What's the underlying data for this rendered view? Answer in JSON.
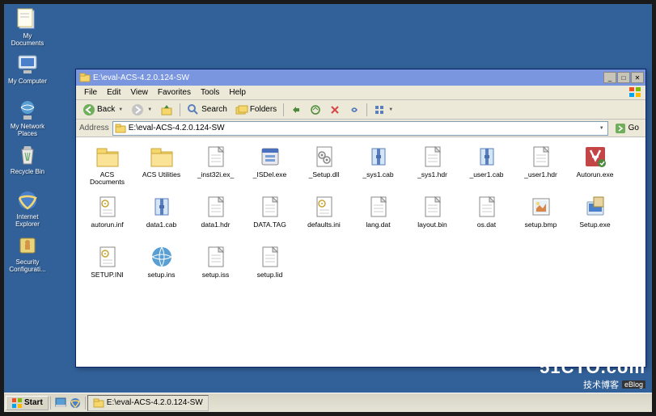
{
  "desktop_icons": [
    {
      "name": "my-documents",
      "label": "My Documents",
      "icon": "docs"
    },
    {
      "name": "my-computer",
      "label": "My Computer",
      "icon": "computer"
    },
    {
      "name": "my-network-places",
      "label": "My Network\nPlaces",
      "icon": "network"
    },
    {
      "name": "recycle-bin",
      "label": "Recycle Bin",
      "icon": "recycle"
    },
    {
      "name": "internet-explorer",
      "label": "Internet\nExplorer",
      "icon": "ie"
    },
    {
      "name": "security-config",
      "label": "Security\nConfigurati...",
      "icon": "security"
    }
  ],
  "window": {
    "title": "E:\\eval-ACS-4.2.0.124-SW",
    "menus": [
      "File",
      "Edit",
      "View",
      "Favorites",
      "Tools",
      "Help"
    ],
    "toolbar": {
      "back": "Back",
      "search": "Search",
      "folders": "Folders"
    },
    "address": {
      "label": "Address",
      "value": "E:\\eval-ACS-4.2.0.124-SW",
      "go": "Go"
    },
    "files": [
      {
        "label": "ACS\nDocuments",
        "icon": "folder"
      },
      {
        "label": "ACS Utilities",
        "icon": "folder"
      },
      {
        "label": "_inst32i.ex_",
        "icon": "file"
      },
      {
        "label": "_ISDel.exe",
        "icon": "exe"
      },
      {
        "label": "_Setup.dll",
        "icon": "dll"
      },
      {
        "label": "_sys1.cab",
        "icon": "cab"
      },
      {
        "label": "_sys1.hdr",
        "icon": "file"
      },
      {
        "label": "_user1.cab",
        "icon": "cab"
      },
      {
        "label": "_user1.hdr",
        "icon": "file"
      },
      {
        "label": "Autorun.exe",
        "icon": "autorun"
      },
      {
        "label": "autorun.inf",
        "icon": "inf"
      },
      {
        "label": "data1.cab",
        "icon": "cab"
      },
      {
        "label": "data1.hdr",
        "icon": "file"
      },
      {
        "label": "DATA.TAG",
        "icon": "file"
      },
      {
        "label": "defaults.ini",
        "icon": "inf"
      },
      {
        "label": "lang.dat",
        "icon": "file"
      },
      {
        "label": "layout.bin",
        "icon": "file"
      },
      {
        "label": "os.dat",
        "icon": "file"
      },
      {
        "label": "setup.bmp",
        "icon": "bmp"
      },
      {
        "label": "Setup.exe",
        "icon": "setup"
      },
      {
        "label": "SETUP.INI",
        "icon": "inf"
      },
      {
        "label": "setup.ins",
        "icon": "globe"
      },
      {
        "label": "setup.iss",
        "icon": "file"
      },
      {
        "label": "setup.lid",
        "icon": "file"
      }
    ]
  },
  "taskbar": {
    "start": "Start",
    "task": "E:\\eval-ACS-4.2.0.124-SW"
  },
  "watermark": {
    "big": "51CTO.com",
    "small": "技术博客",
    "blog": "eBlog"
  }
}
